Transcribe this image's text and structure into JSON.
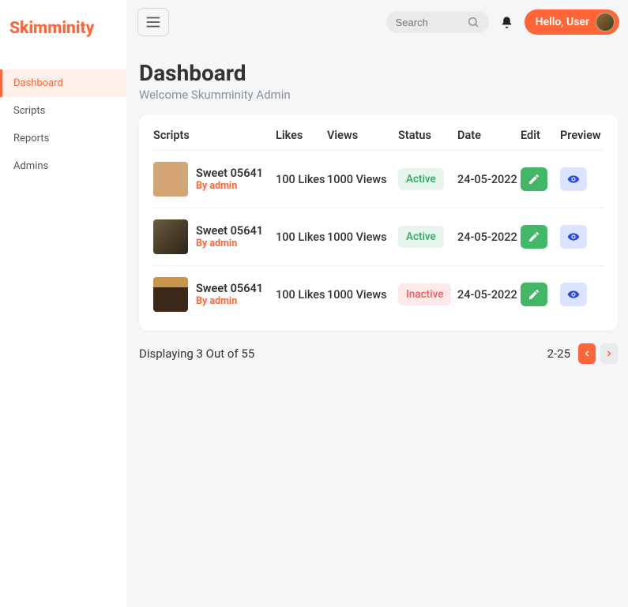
{
  "logo": "Skimminity",
  "sidebar": {
    "items": [
      {
        "label": "Dashboard",
        "active": true
      },
      {
        "label": "Scripts",
        "active": false
      },
      {
        "label": "Reports",
        "active": false
      },
      {
        "label": "Admins",
        "active": false
      }
    ]
  },
  "search": {
    "placeholder": "Search"
  },
  "user_greeting": "Hello, User",
  "page": {
    "title": "Dashboard",
    "subtitle": "Welcome Skumminity Admin"
  },
  "table": {
    "headers": {
      "scripts": "Scripts",
      "likes": "Likes",
      "views": "Views",
      "status": "Status",
      "date": "Date",
      "edit": "Edit",
      "preview": "Preview"
    },
    "rows": [
      {
        "title": "Sweet 05641",
        "by": "By admin",
        "likes": "100 Likes",
        "views": "1000 Views",
        "status": "Active",
        "status_type": "active",
        "date": "24-05-2022"
      },
      {
        "title": "Sweet 05641",
        "by": "By admin",
        "likes": "100 Likes",
        "views": "1000 Views",
        "status": "Active",
        "status_type": "active",
        "date": "24-05-2022"
      },
      {
        "title": "Sweet 05641",
        "by": "By admin",
        "likes": "100 Likes",
        "views": "1000 Views",
        "status": "Inactive",
        "status_type": "inactive",
        "date": "24-05-2022"
      }
    ]
  },
  "footer": {
    "displaying": "Displaying 3 Out of 55",
    "range": "2-25"
  }
}
